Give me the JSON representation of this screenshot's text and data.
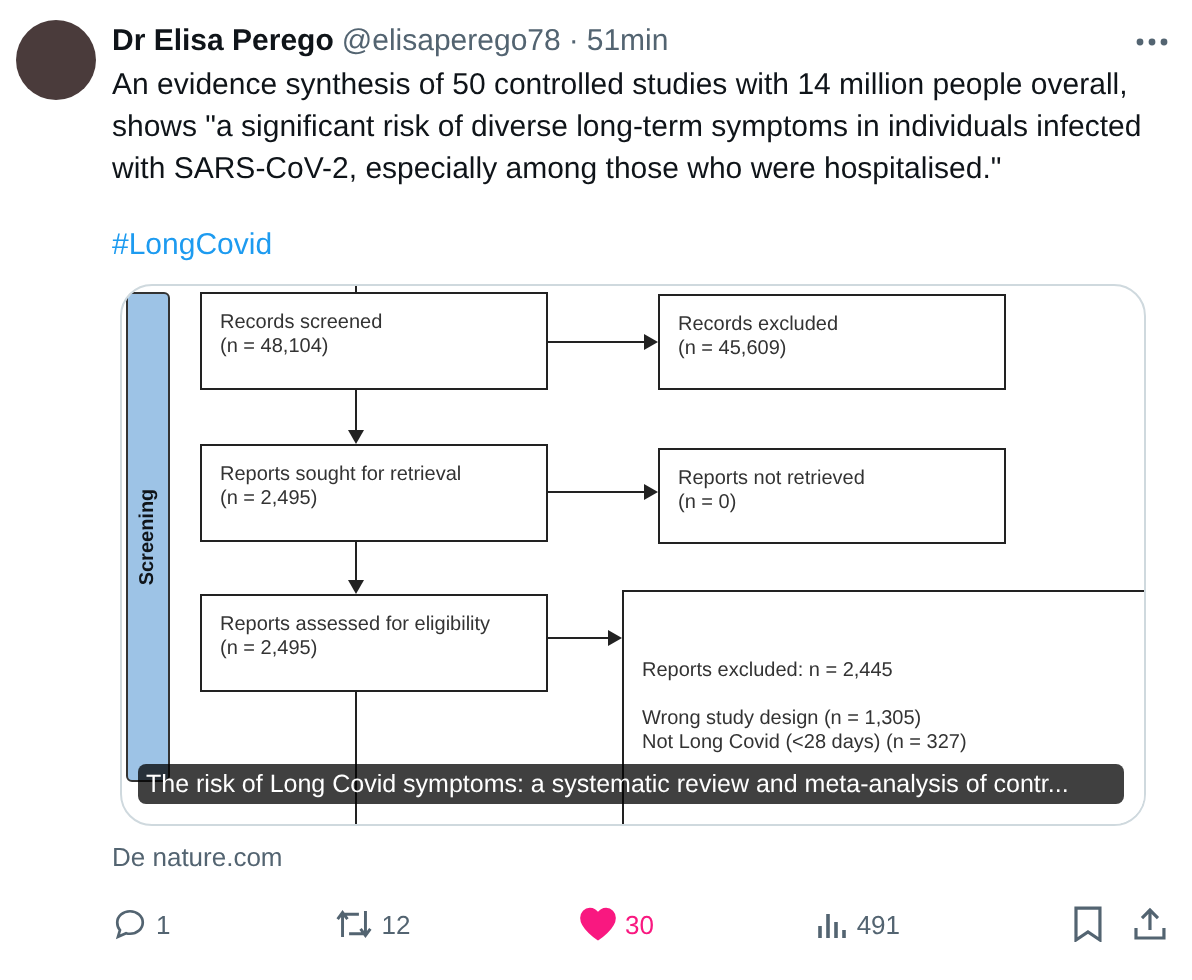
{
  "author": {
    "name": "Dr Elisa Perego",
    "handle": "@elisaperego78",
    "separator": "·",
    "time": "51min"
  },
  "text": "An evidence synthesis of 50 controlled studies with 14 million people overall, shows \"a significant risk of diverse long-term symptoms in individuals infected with SARS-CoV-2, especially among those who were hospitalised.\"",
  "hashtag": "#LongCovid",
  "card": {
    "side_label": "Screening",
    "boxes": [
      {
        "lines": [
          "Records screened",
          "(n = 48,104)"
        ]
      },
      {
        "lines": [
          "Records excluded",
          "(n = 45,609)"
        ]
      },
      {
        "lines": [
          "Reports sought for retrieval",
          "(n = 2,495)"
        ]
      },
      {
        "lines": [
          "Reports not retrieved",
          "(n = 0)"
        ]
      },
      {
        "lines": [
          "Reports assessed for eligibility",
          "(n = 2,495)"
        ]
      },
      {
        "lines": [
          "Reports excluded: n = 2,445"
        ],
        "details": [
          "Wrong study design (n = 1,305)",
          "Not Long Covid (<28 days) (n = 327)"
        ]
      }
    ],
    "caption": "The risk of Long Covid symptoms: a systematic review and meta-analysis of contr..."
  },
  "source": "De nature.com",
  "actions": {
    "replies": "1",
    "reposts": "12",
    "likes": "30",
    "liked": true,
    "views": "491"
  }
}
